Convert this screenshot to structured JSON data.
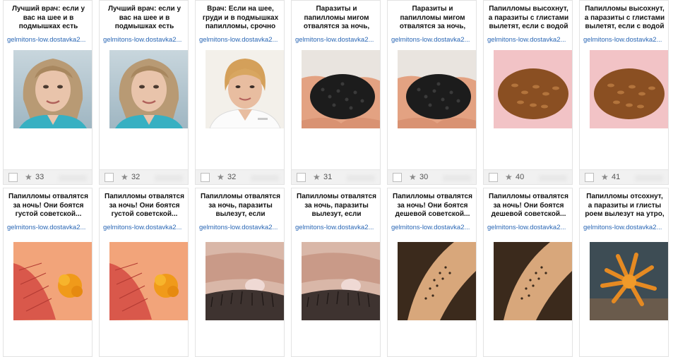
{
  "cards": [
    {
      "title": "Лучший врач: если у вас на шее и в подмышках есть",
      "domain": "gelmitons-low.dostavka2...",
      "rating": "33",
      "image": "woman-blond"
    },
    {
      "title": "Лучший врач: если у вас на шее и в подмышках есть",
      "domain": "gelmitons-low.dostavka2...",
      "rating": "32",
      "image": "woman-blond"
    },
    {
      "title": "Врач: Если на шее, груди и в подмышках папилломы, срочно",
      "domain": "gelmitons-low.dostavka2...",
      "rating": "32",
      "image": "doctor-woman"
    },
    {
      "title": "Паразиты и папилломы мигом отвалятся за ночь,",
      "domain": "gelmitons-low.dostavka2...",
      "rating": "31",
      "image": "black-seeds"
    },
    {
      "title": "Паразиты и папилломы мигом отвалятся за ночь,",
      "domain": "gelmitons-low.dostavka2...",
      "rating": "30",
      "image": "black-seeds"
    },
    {
      "title": "Папилломы высохнут, а паразиты с глистами вылетят, если с водой",
      "domain": "gelmitons-low.dostavka2...",
      "rating": "40",
      "image": "flax-seeds"
    },
    {
      "title": "Папилломы высохнут, а паразиты с глистами вылетят, если с водой",
      "domain": "gelmitons-low.dostavka2...",
      "rating": "41",
      "image": "flax-seeds"
    },
    {
      "title": "Папилломы отвалятся за ночь! Они боятся густой советской...",
      "domain": "gelmitons-low.dostavka2...",
      "rating": "",
      "image": "orange-growth"
    },
    {
      "title": "Папилломы отвалятся за ночь! Они боятся густой советской...",
      "domain": "gelmitons-low.dostavka2...",
      "rating": "",
      "image": "orange-growth"
    },
    {
      "title": "Папилломы отвалятся за ночь, паразиты вылезут, если",
      "domain": "gelmitons-low.dostavka2...",
      "rating": "",
      "image": "eyelid"
    },
    {
      "title": "Папилломы отвалятся за ночь, паразиты вылезут, если",
      "domain": "gelmitons-low.dostavka2...",
      "rating": "",
      "image": "eyelid"
    },
    {
      "title": "Папилломы отвалятся за ночь! Они боятся дешевой советской...",
      "domain": "gelmitons-low.dostavka2...",
      "rating": "",
      "image": "spotted-skin"
    },
    {
      "title": "Папилломы отвалятся за ночь! Они боятся дешевой советской...",
      "domain": "gelmitons-low.dostavka2...",
      "rating": "",
      "image": "spotted-skin"
    },
    {
      "title": "Папилломы отсохнут, а паразиты и глисты роем вылезут на утро,",
      "domain": "gelmitons-low.dostavka2...",
      "rating": "",
      "image": "orange-coral"
    }
  ],
  "icons": {
    "rating": "star-icon",
    "select": "checkbox-icon"
  }
}
